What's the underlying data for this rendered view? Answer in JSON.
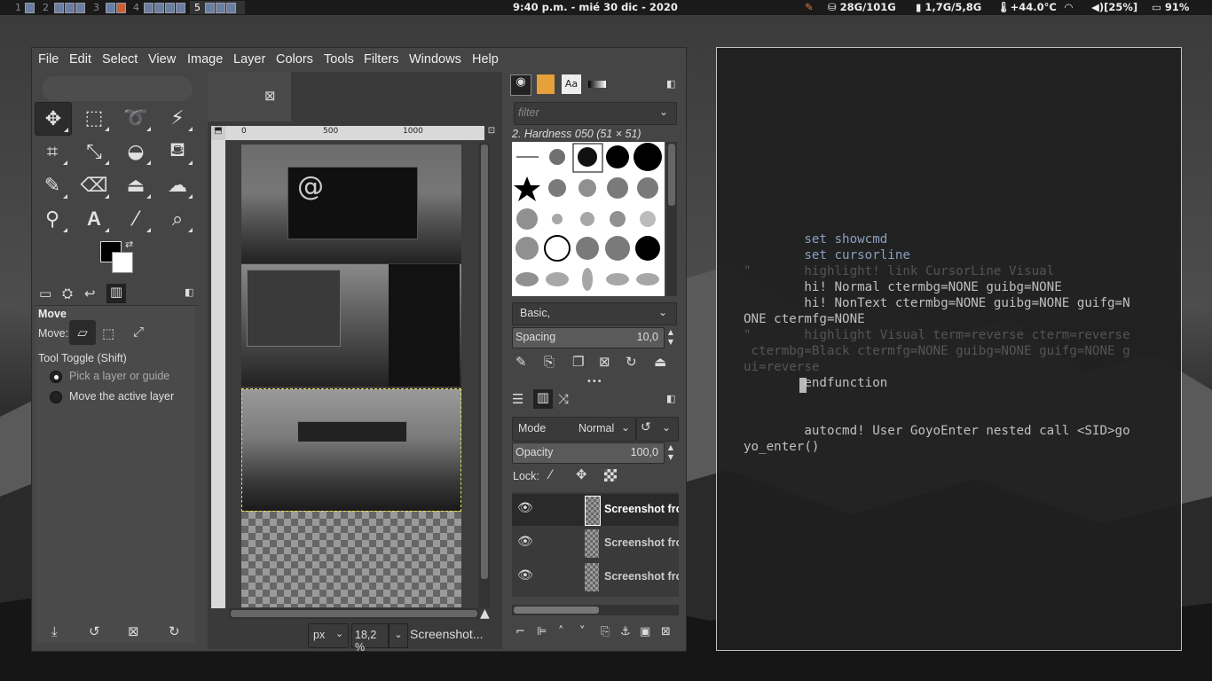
{
  "topbar": {
    "workspaces": [
      "1",
      "2",
      "3",
      "4",
      "5"
    ],
    "active_workspace": "5",
    "clock": "9:40 p.m. - mié 30 dic - 2020",
    "stats": {
      "disk": "28G/101G",
      "memory": "1,7G/5,8G",
      "temp": "+44.0°C",
      "volume": "[25%]",
      "battery": "91%"
    }
  },
  "gimp": {
    "menu": [
      "File",
      "Edit",
      "Select",
      "View",
      "Image",
      "Layer",
      "Colors",
      "Tools",
      "Filters",
      "Windows",
      "Help"
    ],
    "tool_options": {
      "title": "Move",
      "move_label": "Move:",
      "toggle_label": "Tool Toggle  (Shift)",
      "option_pick": "Pick a layer or guide",
      "option_move": "Move the active layer"
    },
    "ruler_marks": [
      "0",
      "500",
      "1000"
    ],
    "statusbar": {
      "unit": "px",
      "zoom": "18,2 %",
      "title": "Screenshot..."
    },
    "brushes": {
      "filter_placeholder": "filter",
      "selected_brush": "2. Hardness 050 (51 × 51)",
      "preset": "Basic,",
      "spacing_label": "Spacing",
      "spacing_value": "10,0"
    },
    "layers": {
      "mode_label": "Mode",
      "mode_value": "Normal",
      "opacity_label": "Opacity",
      "opacity_value": "100,0",
      "lock_label": "Lock:",
      "items": [
        {
          "name": "Screenshot fro"
        },
        {
          "name": "Screenshot fro"
        },
        {
          "name": "Screenshot fro"
        }
      ]
    }
  },
  "terminal": {
    "lines": [
      "        set showcmd",
      "        set cursorline",
      "\"       highlight! link CursorLine Visual",
      "        hi! Normal ctermbg=NONE guibg=NONE",
      "        hi! NonText ctermbg=NONE guibg=NONE guifg=N",
      "ONE ctermfg=NONE",
      "\"       highlight Visual term=reverse cterm=reverse",
      " ctermbg=Black ctermfg=NONE guibg=NONE guifg=NONE g",
      "ui=reverse",
      "        endfunction",
      "",
      "",
      "        autocmd! User GoyoEnter nested call <SID>go",
      "yo_enter()"
    ]
  },
  "colors": {
    "gimp_bg": "#454545",
    "terminal_bg": "#1f1f1f",
    "highlight_red": "#d26b6b",
    "highlight_yellow": "#e8d36b"
  }
}
